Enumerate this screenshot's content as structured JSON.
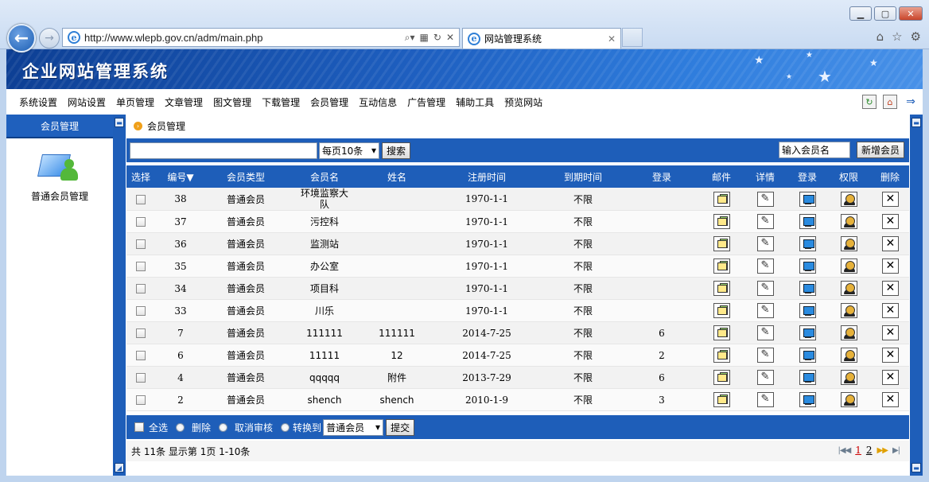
{
  "browser": {
    "url": "http://www.wlepb.gov.cn/adm/main.php",
    "tab_title": "网站管理系统"
  },
  "site": {
    "title": "企业网站管理系统"
  },
  "menu": [
    "系统设置",
    "网站设置",
    "单页管理",
    "文章管理",
    "图文管理",
    "下载管理",
    "会员管理",
    "互动信息",
    "广告管理",
    "辅助工具",
    "预览网站"
  ],
  "left": {
    "header": "会员管理",
    "link": "普通会员管理"
  },
  "breadcrumb": "会员管理",
  "search": {
    "query": "",
    "per_page": "每页10条",
    "search_button": "搜索",
    "member_name_placeholder": "输入会员名",
    "add_button": "新增会员"
  },
  "table": {
    "headers": {
      "select": "选择",
      "id": "编号▼",
      "type": "会员类型",
      "name": "会员名",
      "realname": "姓名",
      "register": "注册时间",
      "expire": "到期时间",
      "logins": "登录",
      "mail": "邮件",
      "detail": "详情",
      "login": "登录",
      "perm": "权限",
      "delete": "删除"
    },
    "rows": [
      {
        "id": "38",
        "type": "普通会员",
        "name": "环境监察大队",
        "realname": "",
        "register": "1970-1-1",
        "expire": "不限",
        "logins": ""
      },
      {
        "id": "37",
        "type": "普通会员",
        "name": "污控科",
        "realname": "",
        "register": "1970-1-1",
        "expire": "不限",
        "logins": ""
      },
      {
        "id": "36",
        "type": "普通会员",
        "name": "监测站",
        "realname": "",
        "register": "1970-1-1",
        "expire": "不限",
        "logins": ""
      },
      {
        "id": "35",
        "type": "普通会员",
        "name": "办公室",
        "realname": "",
        "register": "1970-1-1",
        "expire": "不限",
        "logins": ""
      },
      {
        "id": "34",
        "type": "普通会员",
        "name": "项目科",
        "realname": "",
        "register": "1970-1-1",
        "expire": "不限",
        "logins": ""
      },
      {
        "id": "33",
        "type": "普通会员",
        "name": "川乐",
        "realname": "",
        "register": "1970-1-1",
        "expire": "不限",
        "logins": ""
      },
      {
        "id": "7",
        "type": "普通会员",
        "name": "111111",
        "realname": "111111",
        "register": "2014-7-25",
        "expire": "不限",
        "logins": "6"
      },
      {
        "id": "6",
        "type": "普通会员",
        "name": "11111",
        "realname": "12",
        "register": "2014-7-25",
        "expire": "不限",
        "logins": "2"
      },
      {
        "id": "4",
        "type": "普通会员",
        "name": "qqqqq",
        "realname": "附件",
        "register": "2013-7-29",
        "expire": "不限",
        "logins": "6"
      },
      {
        "id": "2",
        "type": "普通会员",
        "name": "shench",
        "realname": "shench",
        "register": "2010-1-9",
        "expire": "不限",
        "logins": "3"
      }
    ]
  },
  "footer": {
    "select_all": "全选",
    "delete": "删除",
    "cancel_audit": "取消审核",
    "convert_to": "转换到",
    "target_type": "普通会员",
    "submit": "提交"
  },
  "pager": {
    "summary": "共 11条 显示第 1页 1-10条",
    "current": "1",
    "next_page": "2"
  }
}
